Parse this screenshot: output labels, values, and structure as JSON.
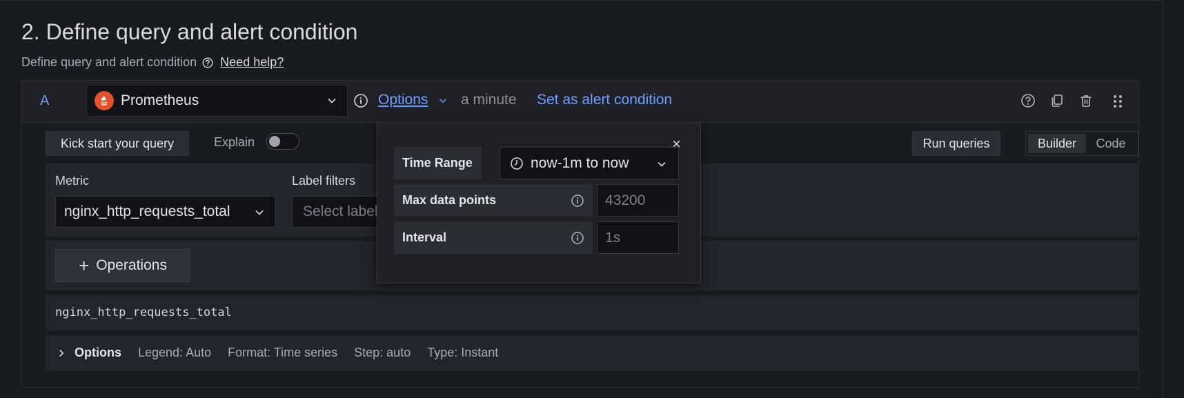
{
  "section": {
    "title": "2. Define query and alert condition",
    "subtitle": "Define query and alert condition",
    "help_link": "Need help?"
  },
  "query": {
    "ref_id": "A",
    "datasource": "Prometheus",
    "options_label": "Options",
    "interval_text": "a minute",
    "alert_condition_label": "Set as alert condition",
    "header_icons": [
      "help-icon",
      "duplicate-icon",
      "trash-icon",
      "drag-handle-icon"
    ]
  },
  "toolbar": {
    "kick_start": "Kick start your query",
    "explain": "Explain",
    "explain_enabled": false,
    "run_queries": "Run queries",
    "mode_builder": "Builder",
    "mode_code": "Code",
    "active_mode": "Builder"
  },
  "builder": {
    "metric_label": "Metric",
    "metric_value": "nginx_http_requests_total",
    "label_filters_label": "Label filters",
    "label_filters_placeholder": "Select label",
    "operations_label": "Operations",
    "raw_query": "nginx_http_requests_total"
  },
  "options_row": {
    "title": "Options",
    "legend": "Legend: Auto",
    "format": "Format: Time series",
    "step": "Step: auto",
    "type": "Type: Instant"
  },
  "options_popover": {
    "time_range_label": "Time Range",
    "time_range_value": "now-1m to now",
    "max_data_points_label": "Max data points",
    "max_data_points_placeholder": "43200",
    "interval_label": "Interval",
    "interval_placeholder": "1s",
    "close_symbol": "×"
  },
  "colors": {
    "background": "#181b1f",
    "panel": "#22252b",
    "accent_link": "#6e9fff",
    "prometheus_brand": "#e6522c"
  }
}
